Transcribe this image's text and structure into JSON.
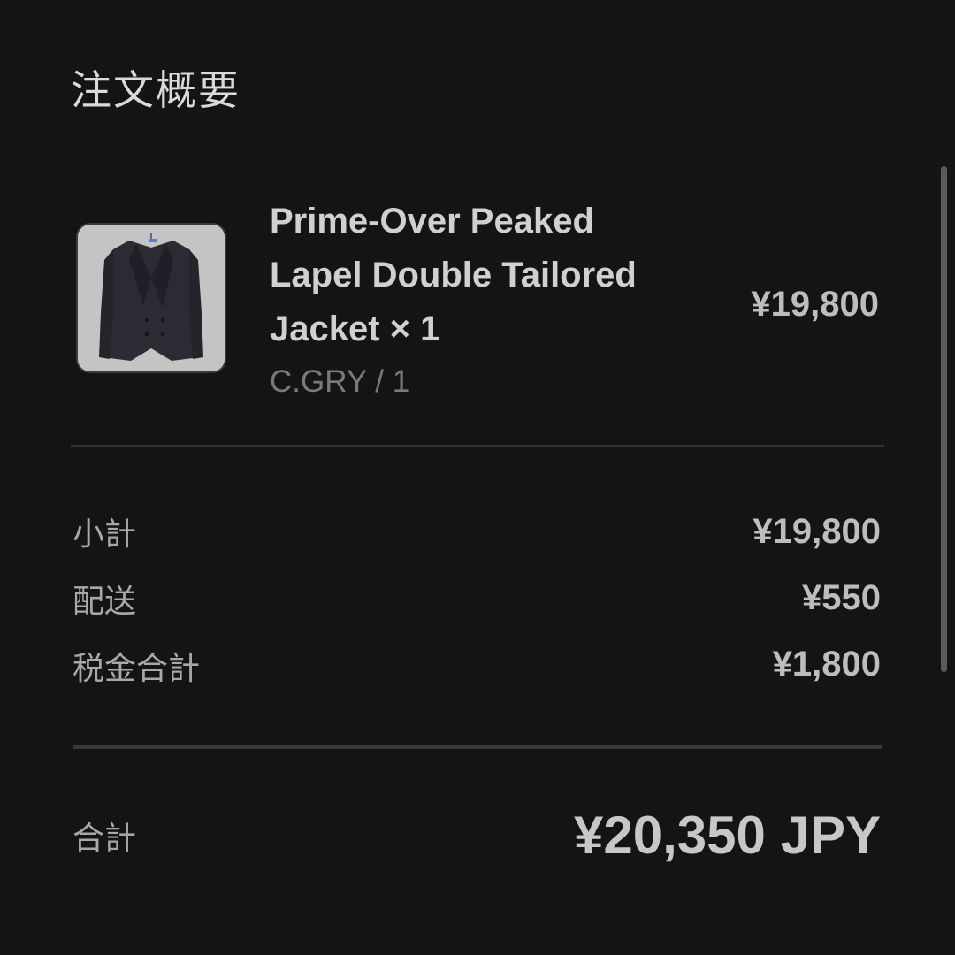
{
  "page": {
    "title": "注文概要"
  },
  "line_item": {
    "image_icon": "jacket-thumbnail",
    "name": "Prime-Over Peaked Lapel Double Tailored Jacket × 1",
    "variant": "C.GRY / 1",
    "price": "¥19,800"
  },
  "summary": {
    "subtotal_label": "小計",
    "subtotal_value": "¥19,800",
    "shipping_label": "配送",
    "shipping_value": "¥550",
    "tax_label": "税金合計",
    "tax_value": "¥1,800"
  },
  "total": {
    "label": "合計",
    "value": "¥20,350 JPY"
  },
  "colors": {
    "background": "#141414",
    "text_primary": "#d0d0d0",
    "text_muted": "#7a7a7a",
    "divider": "#333333"
  }
}
